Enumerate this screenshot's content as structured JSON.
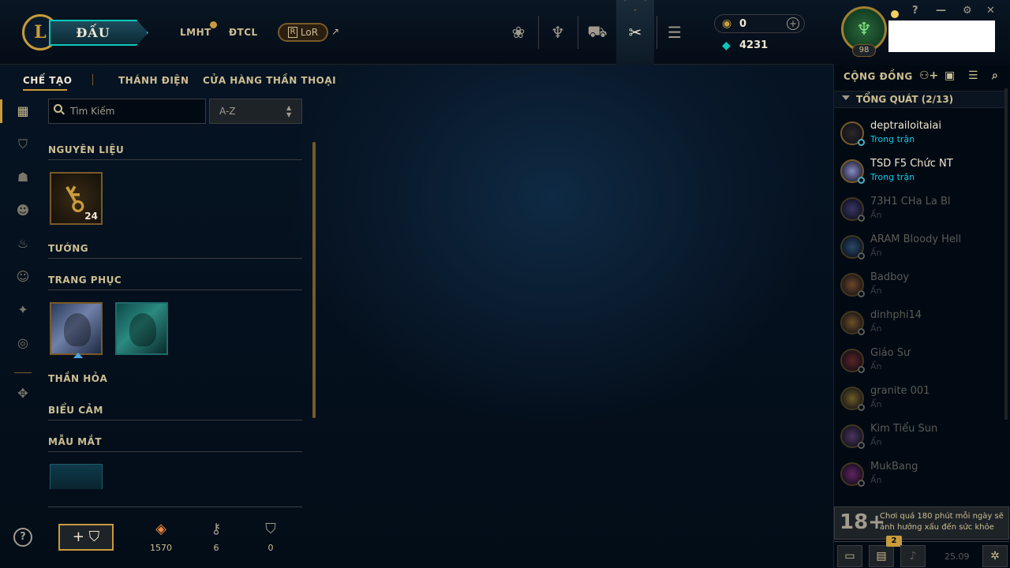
{
  "header": {
    "logo_letter": "L",
    "play_label": "ĐẤU",
    "nav": [
      "LMHT",
      "ĐTCL"
    ],
    "lor_label": "LoR",
    "lor_letter": "R",
    "external_icon": "↗",
    "game_icons": [
      "lotus-icon",
      "trophy-icon",
      "shop-icon",
      "crafting-icon",
      "store-coins-icon"
    ],
    "rp": "0",
    "be": "4231",
    "add_label": "+"
  },
  "profile": {
    "level": "98",
    "window_controls": [
      "?",
      "—",
      "⚙",
      "✕"
    ]
  },
  "subnav": {
    "tabs": [
      "CHẾ TẠO",
      "THÁNH ĐIỆN",
      "CỬA HÀNG THẦN THOẠI"
    ],
    "active": 0
  },
  "filters": {
    "search_placeholder": "Tìm Kiếm",
    "sort_value": "A-Z"
  },
  "sections": {
    "materials": "NGUYÊN LIỆU",
    "champions": "TƯỚNG",
    "skins": "TRANG PHỤC",
    "eternals": "THẦN HỎA",
    "emotes": "BIỂU CẢM",
    "ward_skins": "MẪU MẮT"
  },
  "items": {
    "key_fragment_count": "24"
  },
  "currencies": [
    {
      "icon": "orange-essence-icon",
      "value": "1570",
      "color": "#e8843c"
    },
    {
      "icon": "key-fragment-icon",
      "value": "6",
      "color": "#a09b8c"
    },
    {
      "icon": "mythic-essence-icon",
      "value": "0",
      "color": "#a09b8c"
    }
  ],
  "craft_button_label": "+ ⛉",
  "help_label": "?",
  "social": {
    "title": "CỘNG ĐỒNG",
    "group_title": "TỔNG QUÁT (2/13)",
    "friends": [
      {
        "name": "deptrailoitaiai",
        "status": "Trong trận",
        "online": true,
        "color": "#2a2a2a"
      },
      {
        "name": "TSD F5 Chức NT",
        "status": "Trong trận",
        "online": true,
        "color": "#8a8ac8"
      },
      {
        "name": "73H1 CHa La Bl",
        "status": "Ẩn",
        "online": false,
        "color": "#6a5aa8"
      },
      {
        "name": "ARAM Bloody Hell",
        "status": "Ẩn",
        "online": false,
        "color": "#4a7ab0"
      },
      {
        "name": "Badboy",
        "status": "Ẩn",
        "online": false,
        "color": "#c87a3a"
      },
      {
        "name": "dinhphi14",
        "status": "Ẩn",
        "online": false,
        "color": "#c88a3a"
      },
      {
        "name": "Giáo Sư",
        "status": "Ẩn",
        "online": false,
        "color": "#a83a3a"
      },
      {
        "name": "granite 001",
        "status": "Ẩn",
        "online": false,
        "color": "#c8a03a"
      },
      {
        "name": "Kim Tiểu Sun",
        "status": "Ẩn",
        "online": false,
        "color": "#8a5a9a"
      },
      {
        "name": "MukBang",
        "status": "Ẩn",
        "online": false,
        "color": "#b03aa0"
      }
    ],
    "warning_age": "18+",
    "warning_text": "Chơi quá 180 phút mỗi ngày sẽ ảnh hưởng xấu đến sức khỏe",
    "missions_badge": "2",
    "version": "25.09"
  },
  "colors": {
    "gold": "#c89b3c",
    "teal": "#0ac8b9",
    "online": "#0acbe6"
  }
}
